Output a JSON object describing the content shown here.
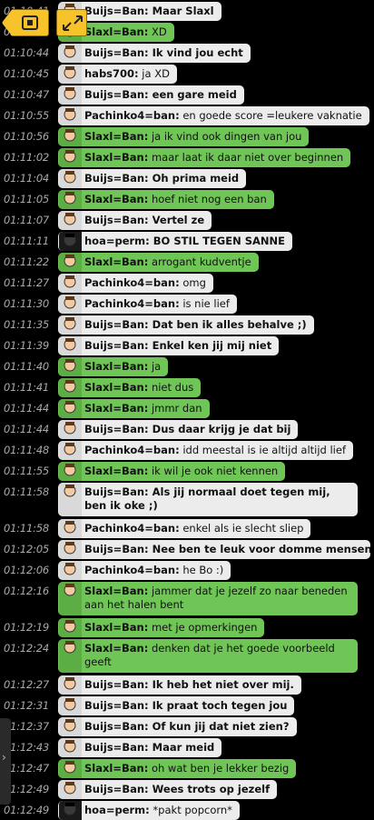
{
  "messages": [
    {
      "time": "01:10:41",
      "name": "Buijs=Ban:",
      "text": " Maar Slaxl",
      "style": "white",
      "bold": true,
      "avatar": "face-avatar-icon"
    },
    {
      "time": "01:10:43",
      "name": "Slaxl=Ban:",
      "text": " XD",
      "style": "green",
      "bold": false,
      "avatar": "clown-avatar-icon"
    },
    {
      "time": "01:10:44",
      "name": "Buijs=Ban:",
      "text": " Ik vind jou echt",
      "style": "white",
      "bold": true,
      "avatar": "face-avatar-icon"
    },
    {
      "time": "01:10:45",
      "name": "habs700:",
      "text": " ja XD",
      "style": "white",
      "bold": false,
      "avatar": "bearded-avatar-icon"
    },
    {
      "time": "01:10:47",
      "name": "Buijs=Ban:",
      "text": " een gare meid",
      "style": "white",
      "bold": true,
      "avatar": "face-avatar-icon"
    },
    {
      "time": "01:10:55",
      "name": "Pachinko4=ban:",
      "text": " en goede score =leukere vaknatie",
      "style": "white",
      "bold": false,
      "avatar": "hat-avatar-icon"
    },
    {
      "time": "01:10:56",
      "name": "Slaxl=Ban:",
      "text": " ja ik vind ook dingen van jou",
      "style": "green",
      "bold": false,
      "avatar": "clown-avatar-icon"
    },
    {
      "time": "01:11:02",
      "name": "Slaxl=Ban:",
      "text": " maar laat ik daar niet over beginnen",
      "style": "green",
      "bold": false,
      "avatar": "clown-avatar-icon"
    },
    {
      "time": "01:11:04",
      "name": "Buijs=Ban:",
      "text": " Oh prima meid",
      "style": "white",
      "bold": true,
      "avatar": "face-avatar-icon"
    },
    {
      "time": "01:11:05",
      "name": "Slaxl=Ban:",
      "text": " hoef niet nog een ban",
      "style": "green",
      "bold": false,
      "avatar": "clown-avatar-icon"
    },
    {
      "time": "01:11:07",
      "name": "Buijs=Ban:",
      "text": " Vertel ze",
      "style": "white",
      "bold": true,
      "avatar": "face-avatar-icon"
    },
    {
      "time": "01:11:11",
      "name": "hoa=perm:",
      "text": " BO STIL TEGEN SANNE",
      "style": "black",
      "bold": true,
      "avatar": "dark-avatar-icon"
    },
    {
      "time": "01:11:22",
      "name": "Slaxl=Ban:",
      "text": " arrogant kudventje",
      "style": "green",
      "bold": false,
      "avatar": "clown-avatar-icon"
    },
    {
      "time": "01:11:27",
      "name": "Pachinko4=ban:",
      "text": " omg",
      "style": "white",
      "bold": false,
      "avatar": "hat-avatar-icon"
    },
    {
      "time": "01:11:30",
      "name": "Pachinko4=ban:",
      "text": " is nie lief",
      "style": "white",
      "bold": false,
      "avatar": "hat-avatar-icon"
    },
    {
      "time": "01:11:35",
      "name": "Buijs=Ban:",
      "text": " Dat ben ik alles behalve ;)",
      "style": "white",
      "bold": true,
      "avatar": "face-avatar-icon"
    },
    {
      "time": "01:11:39",
      "name": "Buijs=Ban:",
      "text": " Enkel ken jij mij niet",
      "style": "white",
      "bold": true,
      "avatar": "face-avatar-icon"
    },
    {
      "time": "01:11:40",
      "name": "Slaxl=Ban:",
      "text": " ja",
      "style": "green",
      "bold": false,
      "avatar": "clown-avatar-icon"
    },
    {
      "time": "01:11:41",
      "name": "Slaxl=Ban:",
      "text": " niet dus",
      "style": "green",
      "bold": false,
      "avatar": "clown-avatar-icon"
    },
    {
      "time": "01:11:44",
      "name": "Slaxl=Ban:",
      "text": " jmmr dan",
      "style": "green",
      "bold": false,
      "avatar": "clown-avatar-icon"
    },
    {
      "time": "01:11:44",
      "name": "Buijs=Ban:",
      "text": " Dus daar krijg je dat bij",
      "style": "white",
      "bold": true,
      "avatar": "face-avatar-icon"
    },
    {
      "time": "01:11:48",
      "name": "Pachinko4=ban:",
      "text": " idd meestal is ie altijd altijd lief",
      "style": "white",
      "bold": false,
      "avatar": "hat-avatar-icon"
    },
    {
      "time": "01:11:55",
      "name": "Slaxl=Ban:",
      "text": " ik wil je ook niet kennen",
      "style": "green",
      "bold": false,
      "avatar": "clown-avatar-icon"
    },
    {
      "time": "01:11:58",
      "name": "Buijs=Ban:",
      "text": " Als jij normaal doet tegen mij, ben ik oke ;)",
      "style": "white",
      "bold": true,
      "tall": true,
      "avatar": "face-avatar-icon"
    },
    {
      "time": "01:11:58",
      "name": "Pachinko4=ban:",
      "text": " enkel als ie slecht sliep",
      "style": "white",
      "bold": false,
      "avatar": "hat-avatar-icon"
    },
    {
      "time": "01:12:05",
      "name": "Buijs=Ban:",
      "text": " Nee ben te leuk voor domme mensen>",
      "style": "white",
      "bold": true,
      "avatar": "face-avatar-icon"
    },
    {
      "time": "01:12:06",
      "name": "Pachinko4=ban:",
      "text": " he Bo :)",
      "style": "white",
      "bold": false,
      "avatar": "hat-avatar-icon"
    },
    {
      "time": "01:12:16",
      "name": "Slaxl=Ban:",
      "text": " jammer dat je jezelf zo naar beneden aan het halen bent",
      "style": "green",
      "bold": false,
      "tall": true,
      "avatar": "clown-avatar-icon"
    },
    {
      "time": "01:12:19",
      "name": "Slaxl=Ban:",
      "text": " met je opmerkingen",
      "style": "green",
      "bold": false,
      "avatar": "clown-avatar-icon"
    },
    {
      "time": "01:12:24",
      "name": "Slaxl=Ban:",
      "text": " denken dat je het goede voorbeeld geeft",
      "style": "green",
      "bold": false,
      "tall": true,
      "avatar": "clown-avatar-icon"
    },
    {
      "time": "01:12:27",
      "name": "Buijs=Ban:",
      "text": " Ik heb het niet over mij.",
      "style": "white",
      "bold": true,
      "avatar": "face-avatar-icon"
    },
    {
      "time": "01:12:31",
      "name": "Buijs=Ban:",
      "text": " Ik praat toch tegen jou",
      "style": "white",
      "bold": true,
      "avatar": "face-avatar-icon"
    },
    {
      "time": "01:12:37",
      "name": "Buijs=Ban:",
      "text": " Of kun jij dat niet zien?",
      "style": "white",
      "bold": true,
      "avatar": "face-avatar-icon"
    },
    {
      "time": "01:12:43",
      "name": "Buijs=Ban:",
      "text": " Maar meid",
      "style": "white",
      "bold": true,
      "avatar": "face-avatar-icon"
    },
    {
      "time": "01:12:47",
      "name": "Slaxl=Ban:",
      "text": " oh wat ben je lekker bezig",
      "style": "green",
      "bold": false,
      "avatar": "clown-avatar-icon"
    },
    {
      "time": "01:12:49",
      "name": "Buijs=Ban:",
      "text": " Wees trots op jezelf",
      "style": "white",
      "bold": true,
      "avatar": "face-avatar-icon"
    },
    {
      "time": "01:12:49",
      "name": "hoa=perm:",
      "text": " *pakt popcorn*",
      "style": "black",
      "bold": false,
      "avatar": "dark-avatar-icon"
    }
  ],
  "toolbar": {
    "history_icon": "history-icon",
    "expand_icon": "expand-icon",
    "sidebar_icon": "chevron-right-icon",
    "sidebar_glyph": "›"
  },
  "colors": {
    "green": "#6fc556",
    "white": "#ececec",
    "accent": "#f6c42a"
  }
}
